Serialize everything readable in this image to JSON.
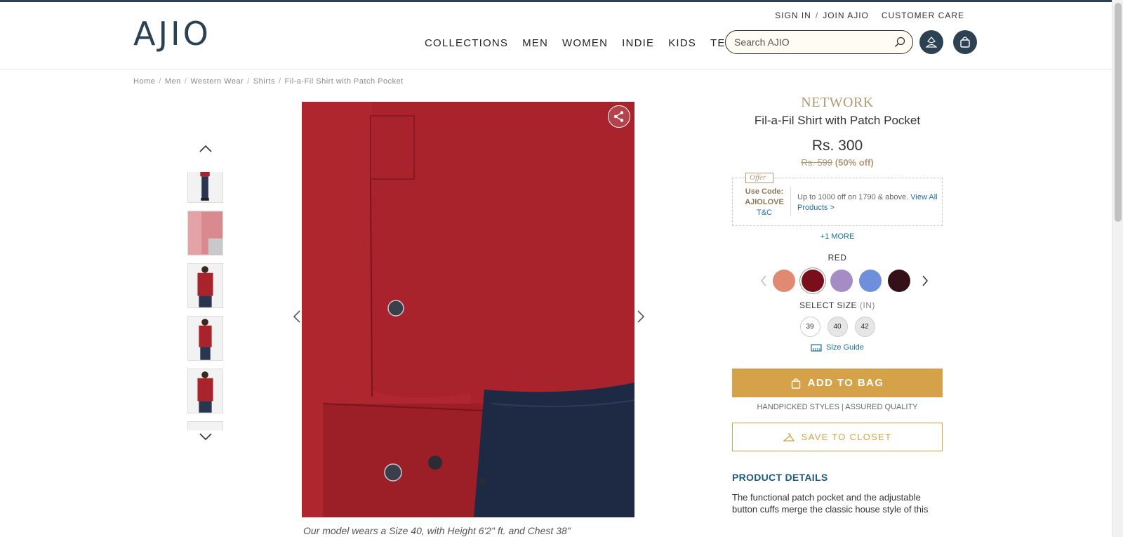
{
  "header": {
    "logo": "AJIO",
    "top_links": [
      "SIGN IN",
      "/",
      "JOIN AJIO",
      "CUSTOMER CARE"
    ],
    "nav": [
      "COLLECTIONS",
      "MEN",
      "WOMEN",
      "INDIE",
      "KIDS",
      "TECH"
    ],
    "search_placeholder": "Search AJIO",
    "icons": {
      "search": "search-icon",
      "user": "user-icon",
      "bag": "bag-icon"
    }
  },
  "breadcrumb": [
    "Home",
    "Men",
    "Western Wear",
    "Shirts",
    "Fil-a-Fil Shirt with Patch Pocket"
  ],
  "gallery": {
    "caption": "Our model wears a Size 40, with Height 6'2\" ft. and Chest 38\"",
    "thumbnails": [
      "full-length-side-view",
      "fabric-close-up",
      "front-view",
      "side-view",
      "front-view-2",
      "partial"
    ]
  },
  "product": {
    "brand": "NETWORK",
    "name": "Fil-a-Fil Shirt with Patch Pocket",
    "price": "Rs. 300",
    "mrp": "Rs. 599",
    "discount": "(50% off)",
    "offer": {
      "tag": "Offer",
      "code_label": "Use Code:",
      "code": "AJIOLOVE",
      "tc": "T&C",
      "desc": "Up to 1000 off on 1790 & above.",
      "link": "View All Products >"
    },
    "more_offers": "+1 MORE",
    "color_label": "RED",
    "swatches": [
      "#e08a72",
      "#7a0f1c",
      "#a58cc4",
      "#6f8fdc",
      "#341018"
    ],
    "selected_swatch": 1,
    "size_label": "SELECT SIZE",
    "size_unit": "(IN)",
    "sizes": [
      {
        "label": "39",
        "available": true
      },
      {
        "label": "40",
        "available": false
      },
      {
        "label": "42",
        "available": false
      }
    ],
    "size_guide": "Size Guide",
    "add_to_bag": "ADD TO BAG",
    "assurance": "HANDPICKED STYLES | ASSURED QUALITY",
    "save_to_closet": "SAVE TO CLOSET",
    "details_title": "PRODUCT DETAILS",
    "details_text": "The functional patch pocket and the adjustable button cuffs merge the classic house style of this"
  },
  "colors": {
    "brand_dark": "#2c4152",
    "gold": "#d5a249",
    "link": "#1a6fa0"
  }
}
